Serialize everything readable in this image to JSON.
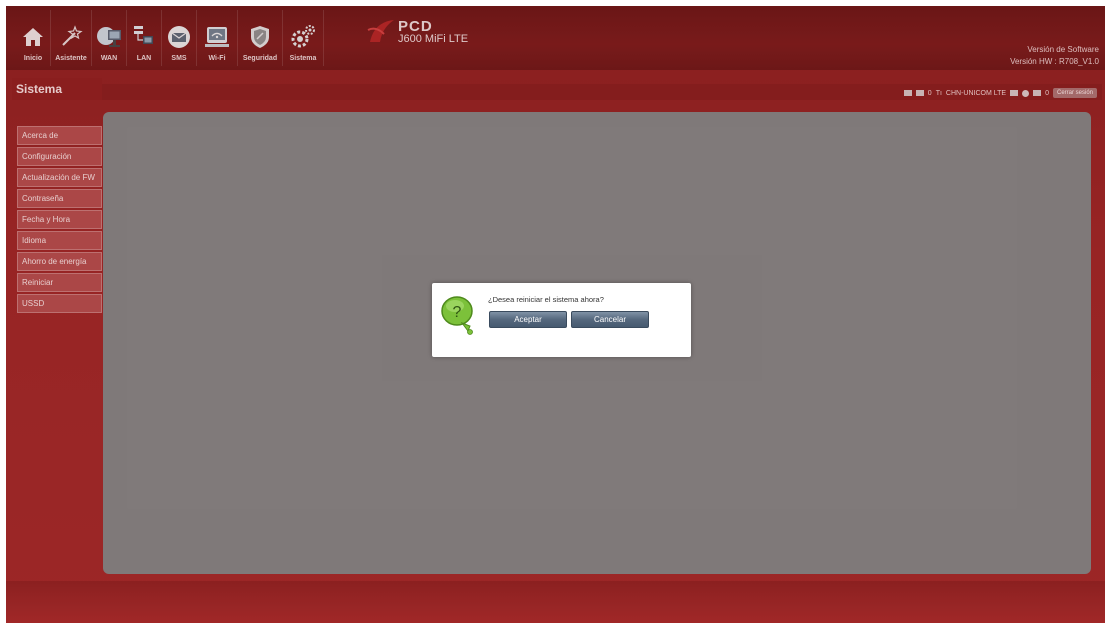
{
  "nav": {
    "items": [
      {
        "label": "Inicio",
        "icon": "home-icon"
      },
      {
        "label": "Asistente",
        "icon": "wizard-icon"
      },
      {
        "label": "WAN",
        "icon": "wan-icon"
      },
      {
        "label": "LAN",
        "icon": "lan-icon"
      },
      {
        "label": "SMS",
        "icon": "sms-icon"
      },
      {
        "label": "Wi-Fi",
        "icon": "wifi-icon"
      },
      {
        "label": "Seguridad",
        "icon": "shield-icon"
      },
      {
        "label": "Sistema",
        "icon": "gear-icon"
      }
    ]
  },
  "brand": {
    "name": "PCD",
    "model": "J600 MiFi LTE"
  },
  "version": {
    "software_label": "Versión de Software",
    "hw_label": "Versión HW : R708_V1.0"
  },
  "section": {
    "title": "Sistema"
  },
  "status": {
    "count1": "0",
    "operator": "CHN-UNICOM LTE",
    "count2": "0",
    "logout": "Cerrar sesión"
  },
  "sidebar": {
    "items": [
      "Acerca de",
      "Configuración",
      "Actualización de FW",
      "Contraseña",
      "Fecha y Hora",
      "Idioma",
      "Ahorro de energía",
      "Reiniciar",
      "USSD"
    ]
  },
  "dialog": {
    "message": "¿Desea reiniciar el sistema ahora?",
    "accept": "Aceptar",
    "cancel": "Cancelar"
  },
  "colors": {
    "brand_red": "#9b2424",
    "button_slate": "#55687e",
    "content_gray": "#818181"
  }
}
